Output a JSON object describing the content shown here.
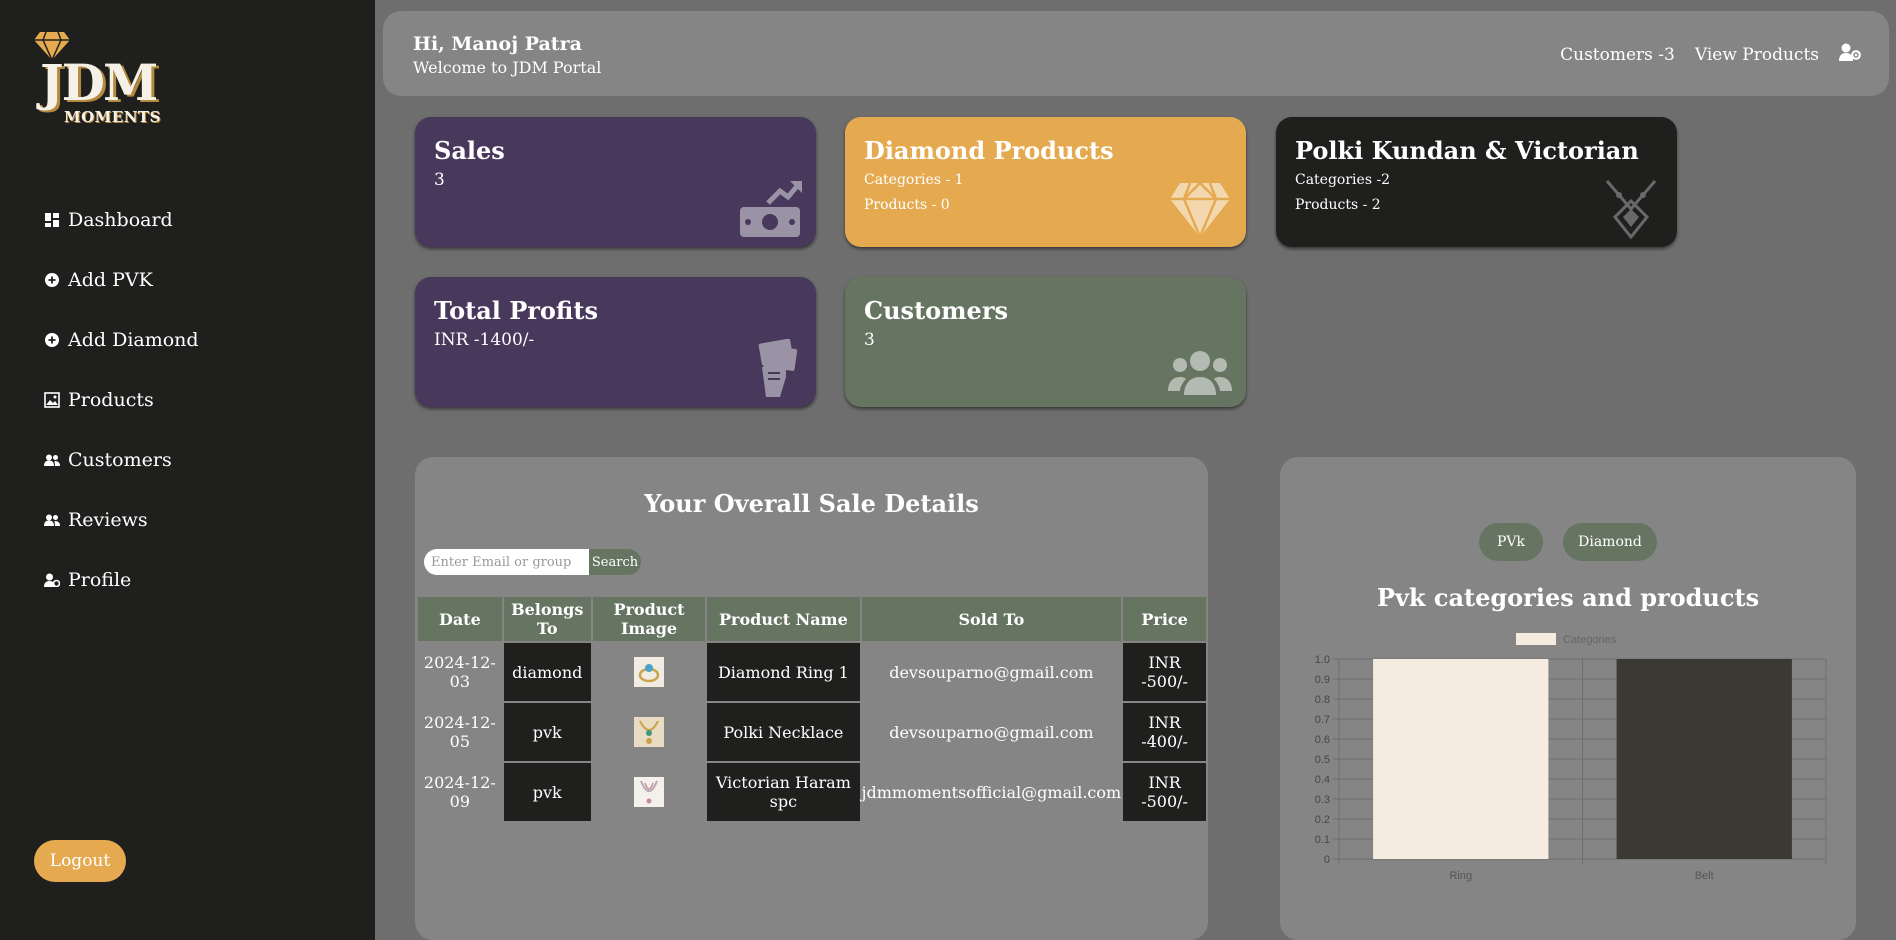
{
  "sidebar": {
    "logo_main": "JDM",
    "logo_sub": "MOMENTS",
    "items": [
      {
        "label": "Dashboard",
        "icon": "dashboard-icon"
      },
      {
        "label": "Add PVK",
        "icon": "plus-circle-icon"
      },
      {
        "label": "Add Diamond",
        "icon": "plus-circle-icon"
      },
      {
        "label": "Products",
        "icon": "image-icon"
      },
      {
        "label": "Customers",
        "icon": "users-icon"
      },
      {
        "label": "Reviews",
        "icon": "users-icon"
      },
      {
        "label": "Profile",
        "icon": "user-gear-icon"
      }
    ],
    "logout_label": "Logout"
  },
  "header": {
    "greeting": "Hi, Manoj Patra",
    "welcome": "Welcome to JDM Portal",
    "customers_link": "Customers -3",
    "view_products": "View Products"
  },
  "cards": {
    "sales": {
      "title": "Sales",
      "value": "3"
    },
    "diamond": {
      "title": "Diamond Products",
      "categories": "Categories - 1",
      "products": "Products - 0"
    },
    "polki": {
      "title": "Polki Kundan & Victorian",
      "categories": "Categories -2",
      "products": "Products - 2"
    },
    "profits": {
      "title": "Total Profits",
      "value": "INR -1400/-"
    },
    "customers": {
      "title": "Customers",
      "value": "3"
    }
  },
  "sales_panel": {
    "title": "Your Overall Sale Details",
    "search_placeholder": "Enter Email or group",
    "search_button": "Search",
    "columns": [
      "Date",
      "Belongs To",
      "Product Image",
      "Product Name",
      "Sold To",
      "Price"
    ],
    "rows": [
      {
        "date": "2024-12-03",
        "belongs": "diamond",
        "name": "Diamond Ring 1",
        "sold_to": "devsouparno@gmail.com",
        "price": "INR -500/-"
      },
      {
        "date": "2024-12-05",
        "belongs": "pvk",
        "name": "Polki Necklace",
        "sold_to": "devsouparno@gmail.com",
        "price": "INR -400/-"
      },
      {
        "date": "2024-12-09",
        "belongs": "pvk",
        "name": "Victorian Haram spc",
        "sold_to": "jdmmomentsofficial@gmail.com",
        "price": "INR -500/-"
      }
    ]
  },
  "chart_panel": {
    "pill_pvk": "PVk",
    "pill_diamond": "Diamond",
    "title": "Pvk categories and products"
  },
  "colors": {
    "purple": "#47385c",
    "orange": "#e5aa4f",
    "black": "#1f201e",
    "green": "#667562",
    "bar_ring": "#f6ebe0",
    "bar_belt": "#3a3a33"
  },
  "chart_data": {
    "type": "bar",
    "categories": [
      "Ring",
      "Belt"
    ],
    "series": [
      {
        "name": "Categories",
        "values": [
          1,
          1
        ]
      }
    ],
    "ylim": [
      0,
      1.0
    ],
    "yticks": [
      "0",
      "0.1",
      "0.2",
      "0.3",
      "0.4",
      "0.5",
      "0.6",
      "0.7",
      "0.8",
      "0.9",
      "1.0"
    ],
    "legend": "top",
    "grid": true
  }
}
